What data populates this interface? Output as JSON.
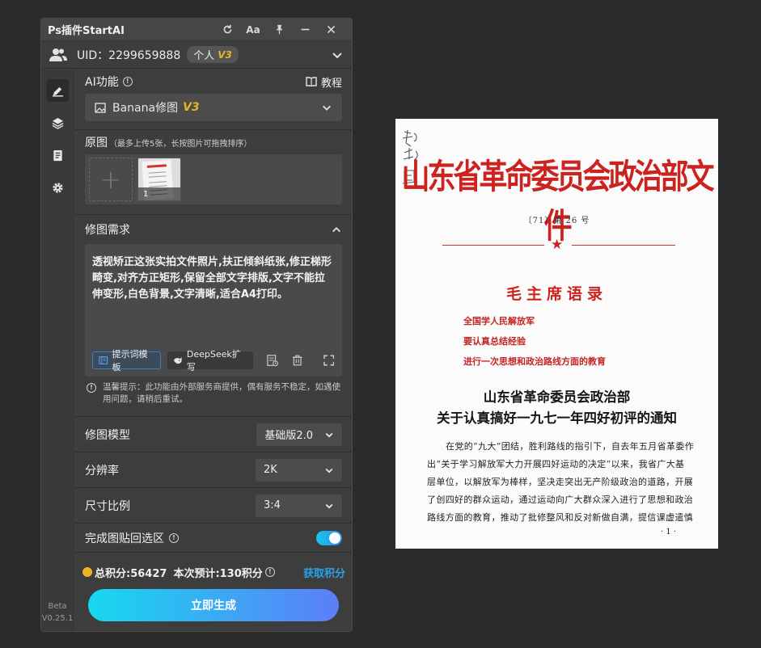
{
  "window": {
    "title": "Ps插件StartAI",
    "font_label": "Aa"
  },
  "user": {
    "uid_text": "UID：2299659888",
    "plan": "个人",
    "plan_level": "V3"
  },
  "sidebar": {
    "version_line1": "Beta",
    "version_line2": "V0.25.1"
  },
  "ai": {
    "label": "AI功能",
    "tutorial": "教程",
    "function_name": "Banana修图",
    "function_level": "V3"
  },
  "original": {
    "label": "原图",
    "hint": "（最多上传5张，长按图片可拖拽排序）",
    "thumb_index": "1"
  },
  "request": {
    "label": "修图需求",
    "prompt": "透视矫正这张实拍文件照片,扶正倾斜纸张,修正梯形畸变,对齐方正矩形,保留全部文字排版,文字不能拉伸变形,白色背景,文字清晰,适合A4打印。",
    "template_btn": "提示词模板",
    "deepseek_btn": "DeepSeek扩写",
    "notice": "温馨提示：此功能由外部服务商提供，偶有服务不稳定，如遇使用问题，请稍后重试。"
  },
  "options": {
    "model_label": "修图模型",
    "model_value": "基础版2.0",
    "resolution_label": "分辨率",
    "resolution_value": "2K",
    "ratio_label": "尺寸比例",
    "ratio_value": "3:4",
    "paste_back_label": "完成图贴回选区",
    "paste_back_on": true
  },
  "footer": {
    "total_points": "总积分:56427",
    "estimate": "本次预计:130积分",
    "get_points": "获取积分",
    "generate": "立即生成"
  },
  "document": {
    "signature": "郑兴局",
    "title": "山东省革命委员会政治部文件",
    "number": "〔71〕第 26 号",
    "quote_title": "毛主席语录",
    "quotes": [
      "全国学人民解放军",
      "要认真总结经验",
      "进行一次思想和政治路线方面的教育"
    ],
    "notice_title_1": "山东省革命委员会政治部",
    "notice_title_2": "关于认真搞好一九七一年四好初评的通知",
    "body": [
      "在党的“九大”团结，胜利路线的指引下，自去年五月省革委作",
      "出“关于学习解放军大力开展四好运动的决定”以来，我省广大基",
      "层单位，以解放军为棒样，坚决走突出无产阶级政治的道路，开展",
      "了创四好的群众运动，通过运动向广大群众深入进行了思想和政治",
      "路线方面的教育，推动了批修整风和反对新做自满，提信课虚遣慎"
    ],
    "page": "· 1 ·"
  },
  "colors": {
    "accent": "#2e8bf0",
    "gold": "#e9b523",
    "doc_red": "#cc2320"
  }
}
